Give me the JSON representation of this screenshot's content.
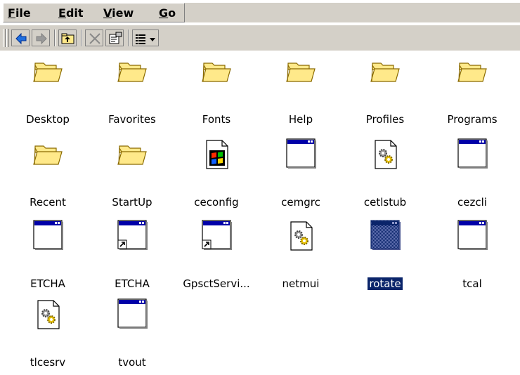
{
  "menu": {
    "file": {
      "u": "F",
      "rest": "ile"
    },
    "edit": {
      "u": "E",
      "rest": "dit"
    },
    "view": {
      "u": "V",
      "rest": "iew"
    },
    "go": {
      "u": "G",
      "rest": "o"
    }
  },
  "toolbar": {
    "buttons": [
      "back-arrow-icon",
      "forward-arrow-icon",
      "up-folder-icon",
      "delete-icon",
      "properties-icon",
      "view-menu-icon"
    ]
  },
  "items": [
    {
      "label": "Desktop",
      "icon": "folder-icon"
    },
    {
      "label": "Favorites",
      "icon": "folder-icon"
    },
    {
      "label": "Fonts",
      "icon": "folder-icon"
    },
    {
      "label": "Help",
      "icon": "folder-icon"
    },
    {
      "label": "Profiles",
      "icon": "folder-icon"
    },
    {
      "label": "Programs",
      "icon": "folder-icon"
    },
    {
      "label": "Recent",
      "icon": "folder-icon"
    },
    {
      "label": "StartUp",
      "icon": "folder-icon"
    },
    {
      "label": "ceconfig",
      "icon": "windows-document-icon"
    },
    {
      "label": "cemgrc",
      "icon": "application-window-icon"
    },
    {
      "label": "cetlstub",
      "icon": "gear-file-icon"
    },
    {
      "label": "cezcli",
      "icon": "application-window-icon"
    },
    {
      "label": "ETCHA",
      "icon": "application-window-icon"
    },
    {
      "label": "ETCHA",
      "icon": "shortcut-window-icon"
    },
    {
      "label": "GpsctServi...",
      "icon": "shortcut-window-icon"
    },
    {
      "label": "netmui",
      "icon": "gear-file-icon"
    },
    {
      "label": "rotate",
      "icon": "application-window-icon",
      "selected": true
    },
    {
      "label": "tcal",
      "icon": "application-window-icon"
    },
    {
      "label": "tlcesrv",
      "icon": "gear-file-icon"
    },
    {
      "label": "tvout",
      "icon": "application-window-icon"
    }
  ],
  "colors": {
    "selection": "#0a246a",
    "chrome": "#d4d0c8",
    "folder": "#ffe98a",
    "title_bar": "#0000a8"
  }
}
